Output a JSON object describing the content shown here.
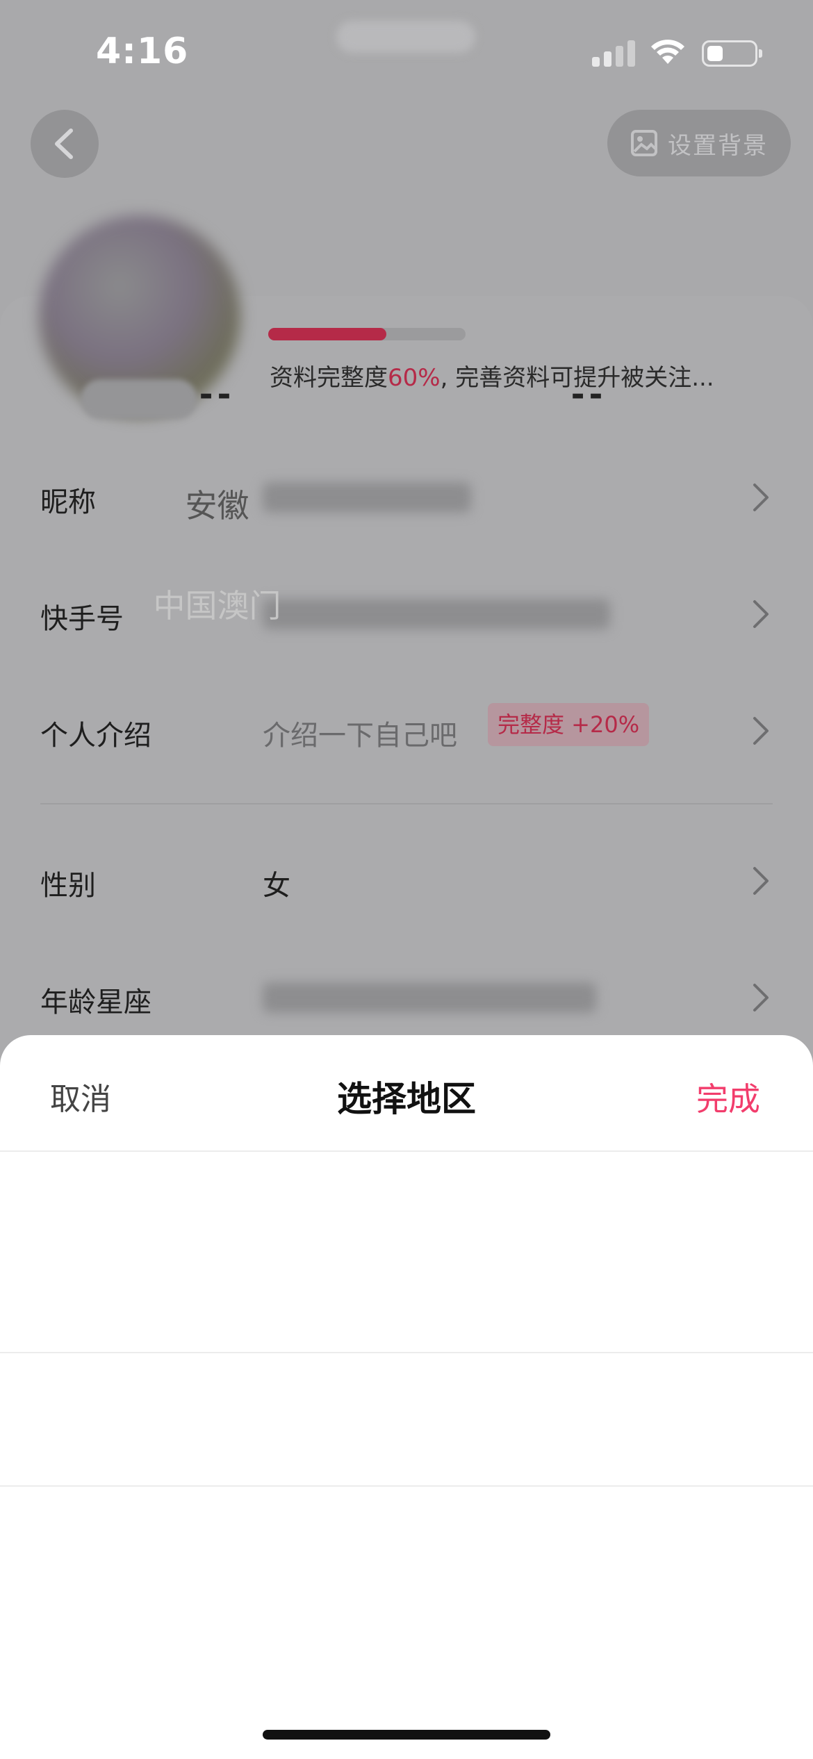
{
  "status_bar": {
    "time": "4:16"
  },
  "header": {
    "set_background_label": "设置背景"
  },
  "profile": {
    "completion_percent": 60,
    "completion_text_prefix": "资料完整度",
    "completion_text_pct": "60%",
    "completion_text_suffix": ", 完善资料可提升被关注..."
  },
  "rows": [
    {
      "label": "昵称",
      "value": ""
    },
    {
      "label": "快手号",
      "value": ""
    },
    {
      "label": "个人介绍",
      "value": "介绍一下自己吧",
      "badge": "完整度 +20%"
    },
    {
      "label": "性别",
      "value": "女"
    },
    {
      "label": "年龄星座",
      "value": ""
    }
  ],
  "sheet": {
    "cancel_label": "取消",
    "title": "选择地区",
    "done_label": "完成",
    "selected_left": "--",
    "selected_right": "--",
    "options_left": [
      "安徽",
      "中国澳门"
    ]
  },
  "colors": {
    "accent": "#f23d6c",
    "progress": "#b52a48"
  }
}
